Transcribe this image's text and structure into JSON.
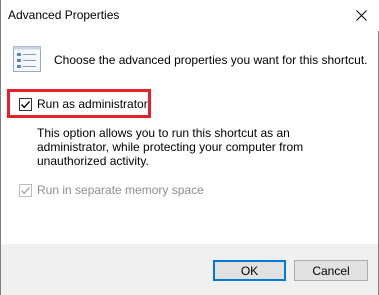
{
  "window": {
    "title": "Advanced Properties",
    "close_icon": "close-icon"
  },
  "main": {
    "icon": "properties-list-icon",
    "prompt": "Choose the advanced properties you want for this shortcut.",
    "run_as_admin": {
      "label": "Run as administrator",
      "checked": true,
      "enabled": true,
      "highlight_color": "#e8202a"
    },
    "description": "This option allows you to run this shortcut as an administrator, while protecting your computer from unauthorized activity.",
    "separate_memory": {
      "label": "Run in separate memory space",
      "checked": true,
      "enabled": false
    }
  },
  "footer": {
    "ok_label": "OK",
    "cancel_label": "Cancel",
    "accent": "#0078d7"
  }
}
